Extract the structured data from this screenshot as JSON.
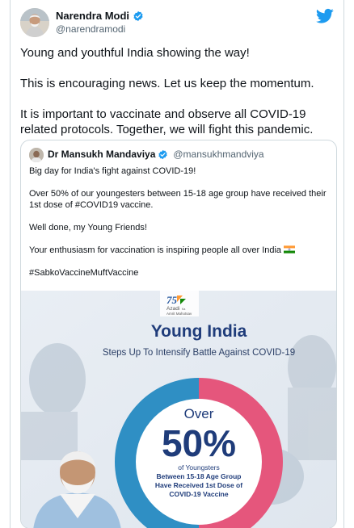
{
  "tweet": {
    "author_name": "Narendra Modi",
    "author_handle": "@narendramodi",
    "paragraphs": [
      "Young and youthful India showing the way!",
      "This is encouraging news. Let us keep the momentum.",
      "It is important to vaccinate and observe all COVID-19 related protocols. Together, we will fight this pandemic."
    ]
  },
  "quoted": {
    "author_name": "Dr Mansukh Mandaviya",
    "author_handle": "@mansukhmandviya",
    "paragraphs": [
      "Big day for India's fight against COVID-19!",
      "Over 50% of our youngesters between 15-18 age group have received their 1st dose of #COVID19 vaccine.",
      "Well done, my Young Friends!",
      "Your enthusiasm for vaccination is inspiring people all over India",
      "#SabkoVaccineMuftVaccine"
    ]
  },
  "poster": {
    "logo_number": "75",
    "logo_line1": "Azadi",
    "logo_ka": "Ka",
    "logo_line2": "Amrit Mahotsav",
    "title": "Young India",
    "subtitle": "Steps Up To Intensify Battle Against COVID-19",
    "over": "Over",
    "percent": "50%",
    "caption_line1": "of Youngsters",
    "caption_line2": "Between 15-18 Age Group",
    "caption_line3": "Have Received 1st Dose of",
    "caption_line4": "COVID-19 Vaccine",
    "donut_fraction": 0.5
  },
  "colors": {
    "twitter_blue": "#1d9bf0",
    "donut_blue": "#2f8fc4",
    "donut_pink": "#e5567c",
    "title_navy": "#1f3c7a"
  },
  "icons": {
    "verified": "verified-badge-icon",
    "bird": "twitter-bird-icon",
    "flag": "india-flag-icon"
  }
}
